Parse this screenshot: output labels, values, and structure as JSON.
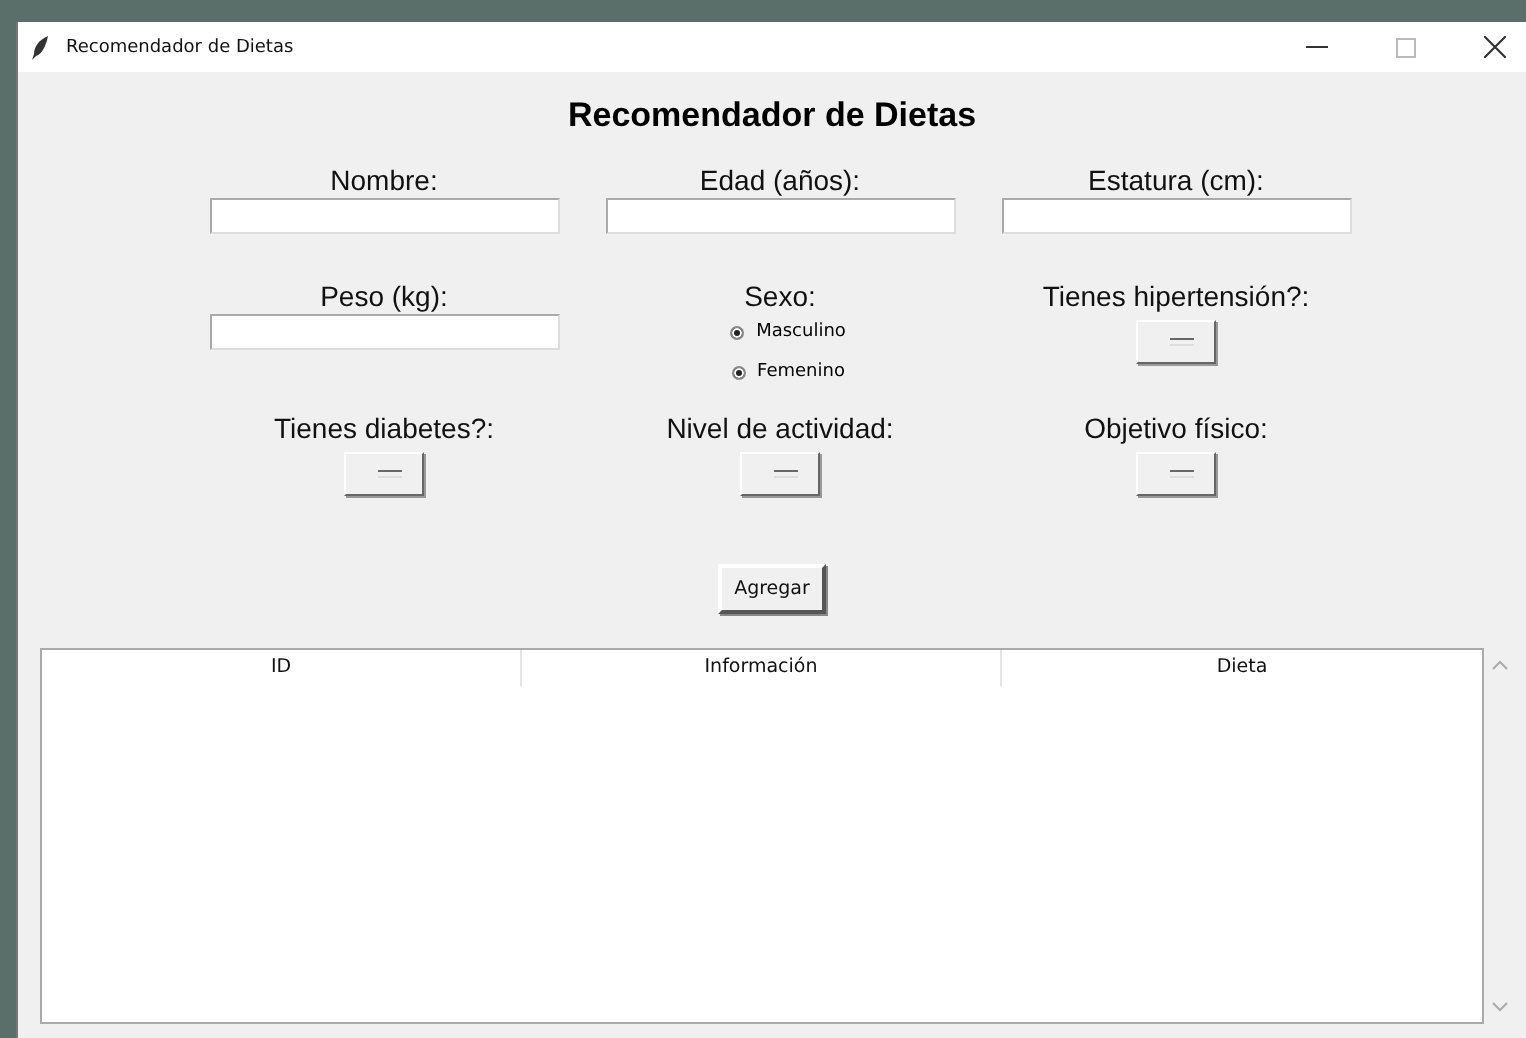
{
  "window": {
    "title": "Recomendador de Dietas"
  },
  "heading": "Recomendador de Dietas",
  "fields": [
    {
      "kind": "entry",
      "label": "Nombre:"
    },
    {
      "kind": "entry",
      "label": "Edad (años):"
    },
    {
      "kind": "entry",
      "label": "Estatura (cm):"
    },
    {
      "kind": "entry",
      "label": "Peso (kg):"
    },
    {
      "kind": "radio",
      "label": "Sexo:",
      "options": [
        {
          "label": "Masculino",
          "selected": true
        },
        {
          "label": "Femenino",
          "selected": true
        }
      ]
    },
    {
      "kind": "menu",
      "label": "Tienes hipertensión?:"
    },
    {
      "kind": "menu",
      "label": "Tienes diabetes?:"
    },
    {
      "kind": "menu",
      "label": "Nivel de actividad:"
    },
    {
      "kind": "menu",
      "label": "Objetivo físico:"
    }
  ],
  "button": "Agregar",
  "table": {
    "columns": [
      "ID",
      "Información",
      "Dieta"
    ]
  }
}
